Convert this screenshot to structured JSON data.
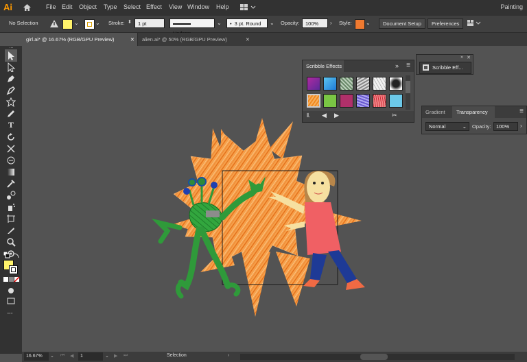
{
  "app": {
    "logo": "Ai",
    "workspace": "Painting"
  },
  "menu": [
    "File",
    "Edit",
    "Object",
    "Type",
    "Select",
    "Effect",
    "View",
    "Window",
    "Help"
  ],
  "control": {
    "selection": "No Selection",
    "stroke_label": "Stroke:",
    "stroke_value": "1 pt",
    "profile": "Uniform",
    "brush": "3 pt. Round",
    "opacity_label": "Opacity:",
    "opacity_value": "100%",
    "style_label": "Style:",
    "document_setup": "Document Setup",
    "preferences": "Preferences"
  },
  "tabs": [
    {
      "label": "girl.ai* @ 16.67% (RGB/GPU Preview)",
      "active": true
    },
    {
      "label": "alien.ai* @ 50% (RGB/GPU Preview)",
      "active": false
    }
  ],
  "panels": {
    "scribble": {
      "title": "Scribble Effects",
      "chip_label": "Scribble Eff..."
    },
    "transparency": {
      "tab_gradient": "Gradient",
      "tab_transparency": "Transparency",
      "blend_mode": "Normal",
      "opacity_label": "Opacity:",
      "opacity_value": "100%"
    }
  },
  "status": {
    "zoom": "16.67%",
    "page": "1",
    "tool": "Selection"
  },
  "colors": {
    "fill": "#fff36b",
    "accent": "#ff9a00",
    "burst": "#f59a3a",
    "shirt": "#f06460",
    "pants": "#1e3a96",
    "alien": "#2e9a3a"
  },
  "icons": [
    "home-icon",
    "workspace-icon",
    "selection-tool-icon",
    "direct-selection-icon",
    "pen-tool-icon",
    "curvature-icon",
    "shape-tool-icon",
    "pencil-tool-icon",
    "type-tool-icon",
    "rotate-icon",
    "scale-icon",
    "warp-icon",
    "gradient-icon",
    "eyedropper-icon",
    "blend-icon",
    "symbol-sprayer-icon",
    "artboard-icon",
    "slice-icon",
    "hand-icon",
    "zoom-icon"
  ]
}
